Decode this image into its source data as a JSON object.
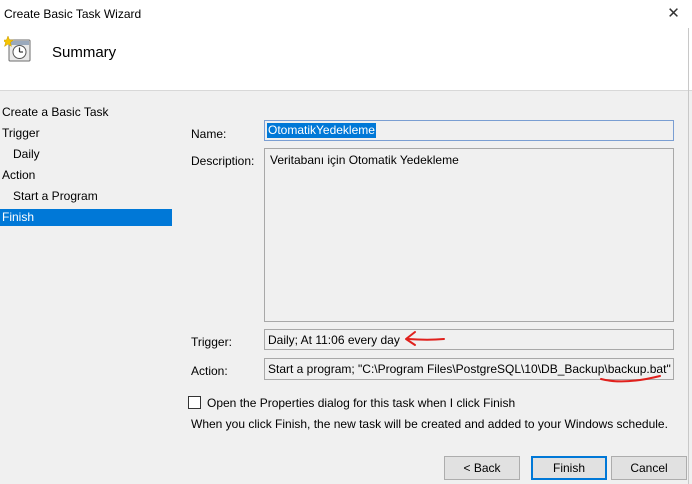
{
  "window": {
    "title": "Create Basic Task Wizard",
    "close_glyph": "✕"
  },
  "header": {
    "title": "Summary",
    "icon": "task-scheduler-clock-icon"
  },
  "nav": {
    "items": [
      {
        "label": "Create a Basic Task",
        "level": 0,
        "active": false
      },
      {
        "label": "Trigger",
        "level": 0,
        "active": false
      },
      {
        "label": "Daily",
        "level": 1,
        "active": false
      },
      {
        "label": "Action",
        "level": 0,
        "active": false
      },
      {
        "label": "Start a Program",
        "level": 1,
        "active": false
      },
      {
        "label": "Finish",
        "level": 0,
        "active": true
      }
    ]
  },
  "summary": {
    "name_label": "Name:",
    "name_value": "OtomatikYedekleme",
    "description_label": "Description:",
    "description_value": "Veritabanı için Otomatik Yedekleme",
    "trigger_label": "Trigger:",
    "trigger_value": "Daily; At 11:06 every day",
    "action_label": "Action:",
    "action_value": "Start a program; \"C:\\Program Files\\PostgreSQL\\10\\DB_Backup\\backup.bat\"",
    "open_properties_label": "Open the Properties dialog for this task when I click Finish",
    "open_properties_checked": false,
    "info_text": "When you click Finish, the new task will be created and added to your Windows schedule."
  },
  "buttons": {
    "back": "< Back",
    "finish": "Finish",
    "cancel": "Cancel"
  },
  "colors": {
    "selection": "#0078d7",
    "annotation": "#e0201c"
  }
}
